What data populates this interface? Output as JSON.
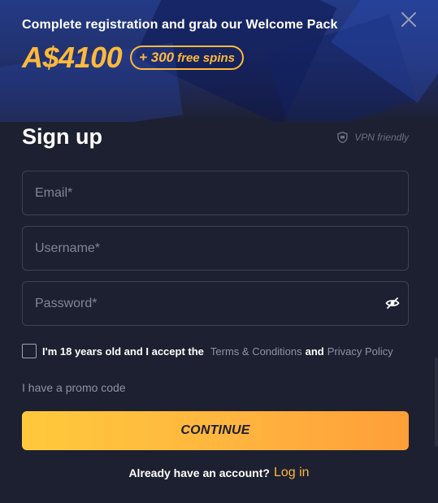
{
  "banner": {
    "welcome_text": "Complete registration and grab our Welcome Pack",
    "bonus_amount": "A$4100",
    "spins_number": "+ 300",
    "spins_text": "free spins"
  },
  "form": {
    "title": "Sign up",
    "vpn_label": "VPN friendly",
    "email_placeholder": "Email*",
    "username_placeholder": "Username*",
    "password_placeholder": "Password*",
    "email_value": "",
    "username_value": "",
    "password_value": "",
    "terms_checked": false,
    "terms_prefix": "I'm 18 years old and I accept the",
    "terms_link": "Terms & Conditions",
    "terms_and": "and",
    "privacy_link": "Privacy Policy",
    "promo_label": "I have a promo code",
    "continue_label": "CONTINUE"
  },
  "footer": {
    "account_question": "Already have an account?",
    "login_link": "Log in"
  },
  "icons": {
    "close": "close-icon",
    "vpn": "shield-icon",
    "password_toggle": "eye-slash-icon"
  },
  "colors": {
    "background": "#1d2030",
    "accent": "#ffb93b",
    "field_border": "#3d4256",
    "muted_text": "#8d92a6"
  }
}
